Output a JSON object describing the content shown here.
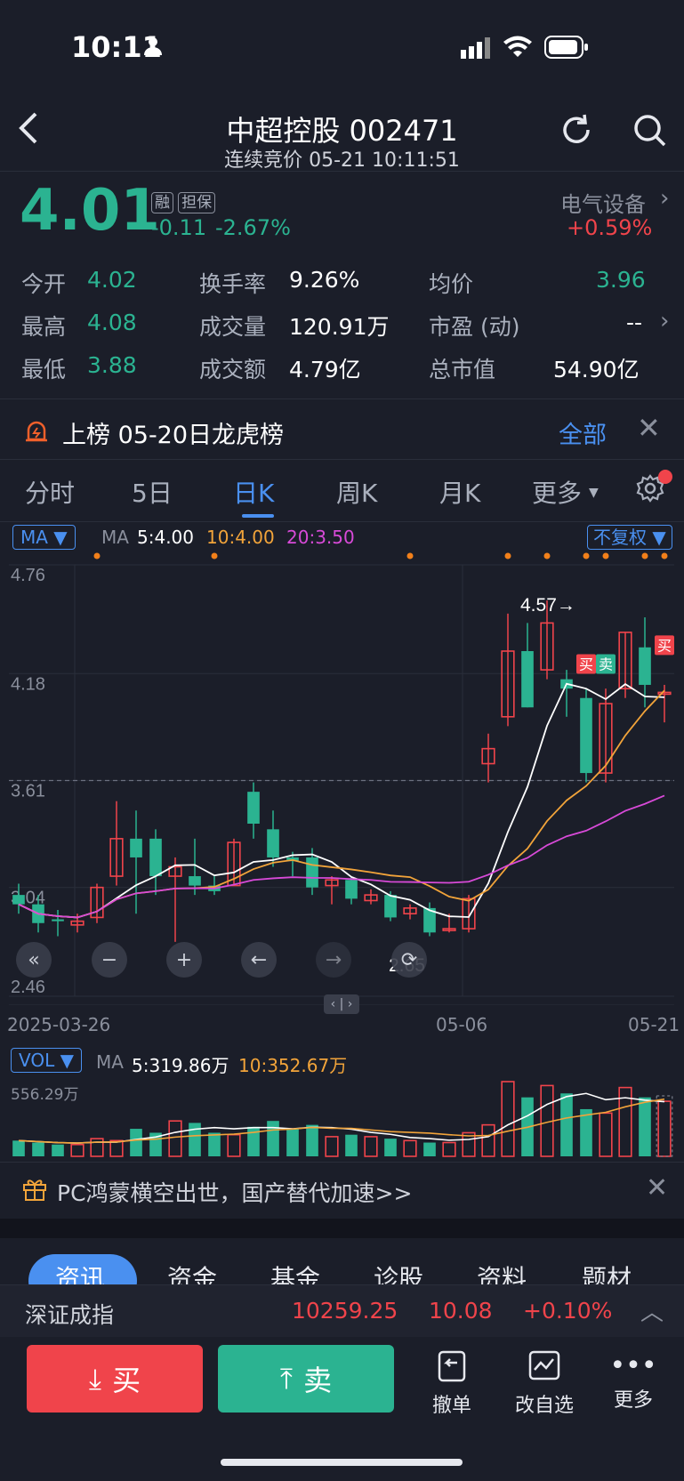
{
  "status_bar": {
    "time": "10:11"
  },
  "header": {
    "title": "中超控股 002471",
    "subtitle": "连续竞价 05-21 10:11:51"
  },
  "quote": {
    "price": "4.01",
    "badges": [
      "融",
      "担保"
    ],
    "change": "-0.11",
    "change_pct": "-2.67%",
    "sector_name": "电气设备",
    "sector_change": "+0.59%"
  },
  "stats": [
    {
      "label": "今开",
      "value": "4.02"
    },
    {
      "label": "换手率",
      "value": "9.26%"
    },
    {
      "label": "均价",
      "value": "3.96"
    },
    {
      "label": "最高",
      "value": "4.08"
    },
    {
      "label": "成交量",
      "value": "120.91万"
    },
    {
      "label": "市盈 (动)",
      "value": "--"
    },
    {
      "label": "最低",
      "value": "3.88"
    },
    {
      "label": "成交额",
      "value": "4.79亿"
    },
    {
      "label": "总市值",
      "value": "54.90亿"
    }
  ],
  "notice": {
    "text": "上榜 05-20日龙虎榜",
    "action": "全部"
  },
  "chart_tabs": [
    "分时",
    "5日",
    "日K",
    "周K",
    "月K",
    "更多"
  ],
  "ma_bar": {
    "selector": "MA",
    "label": "MA",
    "ma5": "5:4.00",
    "ma10": "10:4.00",
    "ma20": "20:3.50",
    "right_selector": "不复权"
  },
  "colors": {
    "up": "#f0444b",
    "down": "#2bb391",
    "ma5": "#ffffff",
    "ma10": "#f2a43a",
    "ma20": "#d84ad8",
    "accent": "#4a90f0",
    "bg": "#1b1e29"
  },
  "chart_data": {
    "type": "candlestick",
    "y_ticks": [
      "4.76",
      "4.18",
      "3.61",
      "3.04",
      "2.46"
    ],
    "ylim": [
      2.46,
      4.76
    ],
    "x_labels": [
      "2025-03-26",
      "05-06",
      "05-21"
    ],
    "annotations": {
      "high_label": "4.57→",
      "low_label": "2.65",
      "buy": "买",
      "sell": "卖"
    },
    "candles": [
      [
        3.0,
        2.95,
        3.06,
        2.9
      ],
      [
        2.95,
        2.85,
        3.0,
        2.8
      ],
      [
        2.87,
        2.86,
        2.92,
        2.78
      ],
      [
        2.84,
        2.86,
        2.9,
        2.8
      ],
      [
        2.88,
        3.04,
        3.06,
        2.85
      ],
      [
        3.1,
        3.3,
        3.5,
        3.05
      ],
      [
        3.3,
        3.2,
        3.45,
        2.9
      ],
      [
        3.3,
        3.1,
        3.35,
        3.0
      ],
      [
        3.1,
        3.15,
        3.2,
        2.75
      ],
      [
        3.1,
        3.05,
        3.3,
        3.0
      ],
      [
        3.05,
        3.02,
        3.1,
        3.0
      ],
      [
        3.05,
        3.28,
        3.3,
        3.05
      ],
      [
        3.55,
        3.38,
        3.6,
        3.3
      ],
      [
        3.35,
        3.2,
        3.45,
        3.15
      ],
      [
        3.2,
        3.18,
        3.23,
        3.1
      ],
      [
        3.2,
        3.04,
        3.25,
        3.0
      ],
      [
        3.05,
        3.08,
        3.1,
        2.95
      ],
      [
        3.08,
        2.98,
        3.1,
        2.95
      ],
      [
        2.97,
        3.0,
        3.03,
        2.95
      ],
      [
        3.0,
        2.88,
        3.02,
        2.86
      ],
      [
        2.9,
        2.93,
        2.95,
        2.87
      ],
      [
        2.93,
        2.8,
        2.96,
        2.78
      ],
      [
        2.82,
        2.82,
        2.9,
        2.8
      ],
      [
        2.82,
        2.98,
        3.0,
        2.8
      ],
      [
        3.7,
        3.78,
        3.86,
        3.6
      ],
      [
        3.95,
        4.3,
        4.5,
        3.9
      ],
      [
        4.3,
        4.0,
        4.45,
        4.0
      ],
      [
        4.2,
        4.45,
        4.57,
        4.15
      ],
      [
        4.15,
        4.1,
        4.2,
        3.95
      ],
      [
        4.05,
        3.65,
        4.1,
        3.6
      ],
      [
        3.65,
        4.02,
        4.1,
        3.6
      ],
      [
        4.1,
        4.4,
        4.4,
        4.05
      ],
      [
        4.32,
        4.12,
        4.48,
        4.0
      ],
      [
        4.08,
        4.08,
        4.12,
        3.92
      ]
    ]
  },
  "vol_bar": {
    "selector": "VOL",
    "label": "MA",
    "ma5": "5:319.86万",
    "ma10": "10:352.67万",
    "max_label": "556.29万"
  },
  "volume_data": {
    "values": [
      40,
      35,
      30,
      30,
      45,
      40,
      70,
      60,
      90,
      85,
      60,
      55,
      75,
      90,
      70,
      80,
      50,
      55,
      50,
      45,
      40,
      35,
      35,
      60,
      80,
      190,
      150,
      180,
      160,
      120,
      110,
      175,
      150,
      140
    ]
  },
  "promo": {
    "text": "PC鸿蒙横空出世，国产替代加速>>"
  },
  "sub_tabs": [
    "资讯",
    "资金",
    "基金",
    "诊股",
    "资料",
    "题材"
  ],
  "index_bar": {
    "name": "深证成指",
    "value": "10259.25",
    "change": "10.08",
    "pct": "+0.10%"
  },
  "actions": {
    "buy": "买",
    "sell": "卖",
    "cancel": "撤单",
    "edit_watch": "改自选",
    "more": "更多"
  }
}
